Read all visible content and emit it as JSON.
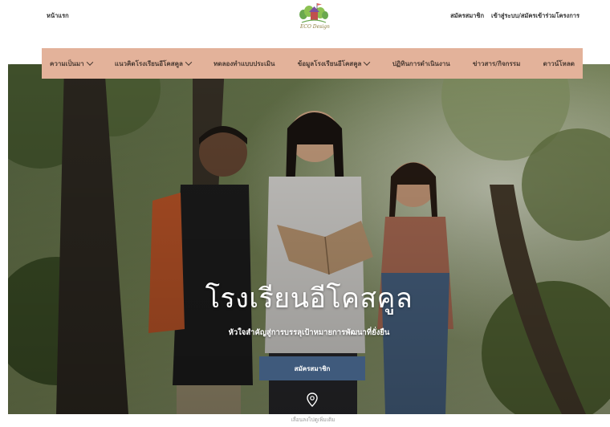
{
  "header": {
    "home_link": "หน้าแรก",
    "logo_text": "ECO Design",
    "right_links": [
      "สมัครสมาชิก",
      "เข้าสู่ระบบ/สมัครเข้าร่วมโครงการ"
    ]
  },
  "nav": {
    "items": [
      {
        "label": "ความเป็นมา",
        "dropdown": true
      },
      {
        "label": "แนวคิดโรงเรียนอีโคสคูล",
        "dropdown": true
      },
      {
        "label": "ทดลองทำแบบประเมิน",
        "dropdown": false
      },
      {
        "label": "ข้อมูลโรงเรียนอีโคสคูล",
        "dropdown": true
      },
      {
        "label": "ปฏิทินการดำเนินงาน",
        "dropdown": false
      },
      {
        "label": "ข่าวสาร/กิจกรรม",
        "dropdown": false
      },
      {
        "label": "ดาวน์โหลด",
        "dropdown": false
      }
    ]
  },
  "hero": {
    "title": "โรงเรียนอีโคสคูล",
    "subtitle": "หัวใจสำคัญสู่การบรรลุเป้าหมายการพัฒนาที่ยั่งยืน",
    "button_label": "สมัครสมาชิก",
    "scroll_hint": "เลื่อนลงไปดูเพิ่มเติม"
  },
  "colors": {
    "nav_bg": "#e3b29a",
    "button_bg": "#3f5a7c"
  }
}
